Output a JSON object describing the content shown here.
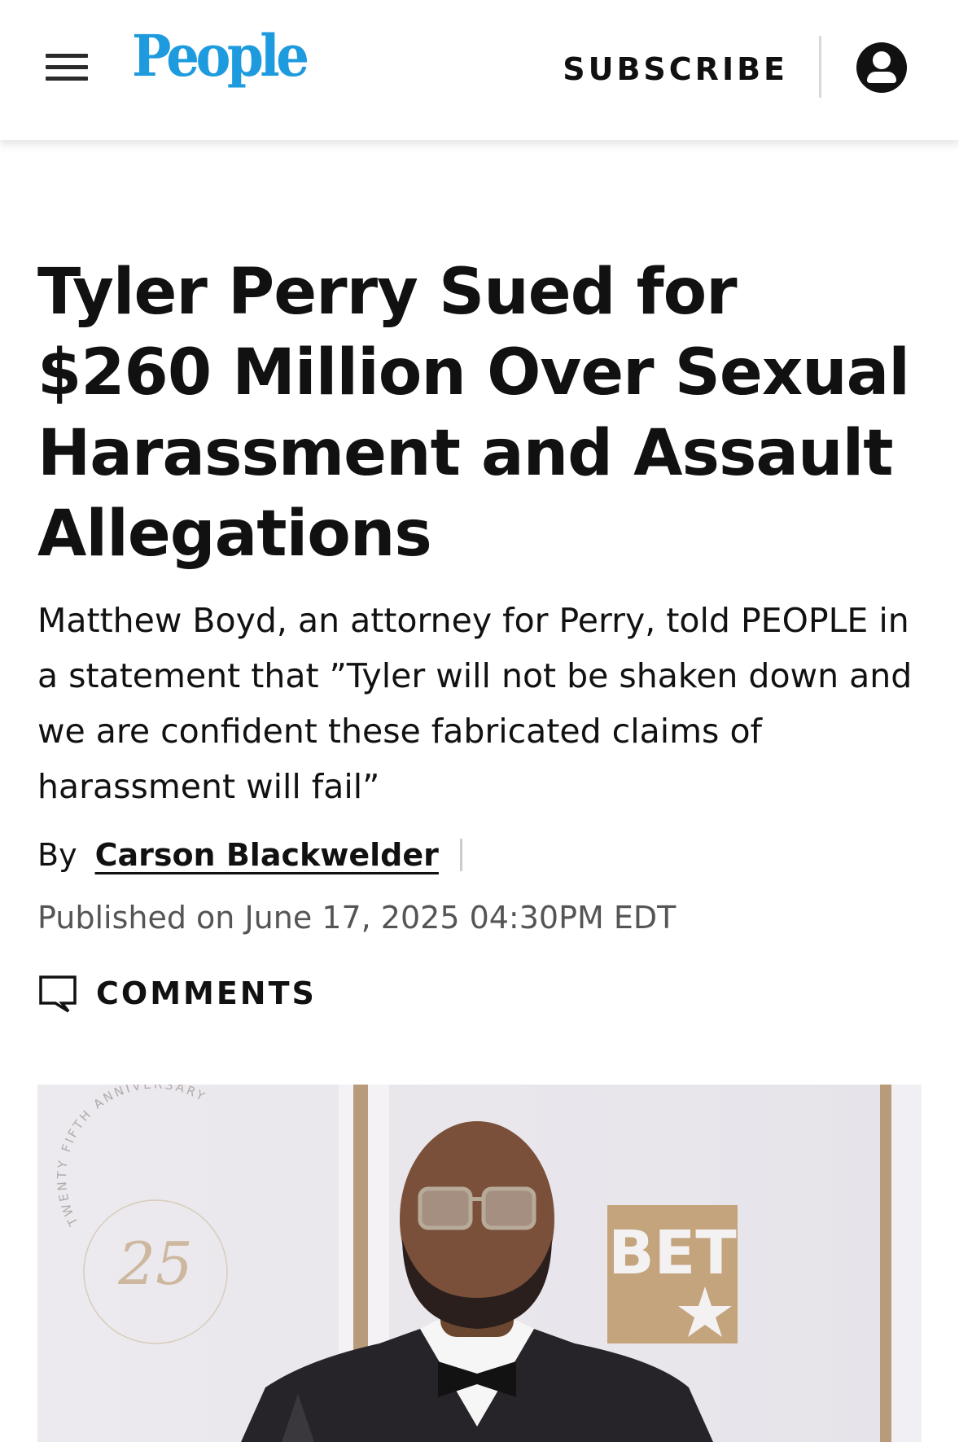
{
  "header": {
    "logo_text": "People",
    "subscribe_label": "SUBSCRIBE",
    "menu_icon": "hamburger-menu-icon",
    "account_icon": "user-account-icon"
  },
  "article": {
    "headline": "Tyler Perry Sued for $260 Million Over Sexual Harassment and Assault Allegations",
    "dek": "Matthew Boyd, an attorney for Perry, told PEOPLE in a statement that ”Tyler will not be shaken down and we are confident these fabricated claims of harassment will fail”",
    "byline_prefix": "By",
    "author": "Carson Blackwelder",
    "published": "Published on June 17, 2025 04:30PM EDT",
    "comments_label": "COMMENTS",
    "comments_icon": "comment-bubble-icon"
  },
  "hero_image": {
    "backdrop_text": "TWENTY FIFTH ANNIVERSARY",
    "backdrop_number": "25",
    "backdrop_logo": "BET"
  },
  "colors": {
    "brand": "#1e9bde",
    "text": "#111111",
    "muted": "#555555",
    "backdrop_gold": "#c4a47c"
  }
}
